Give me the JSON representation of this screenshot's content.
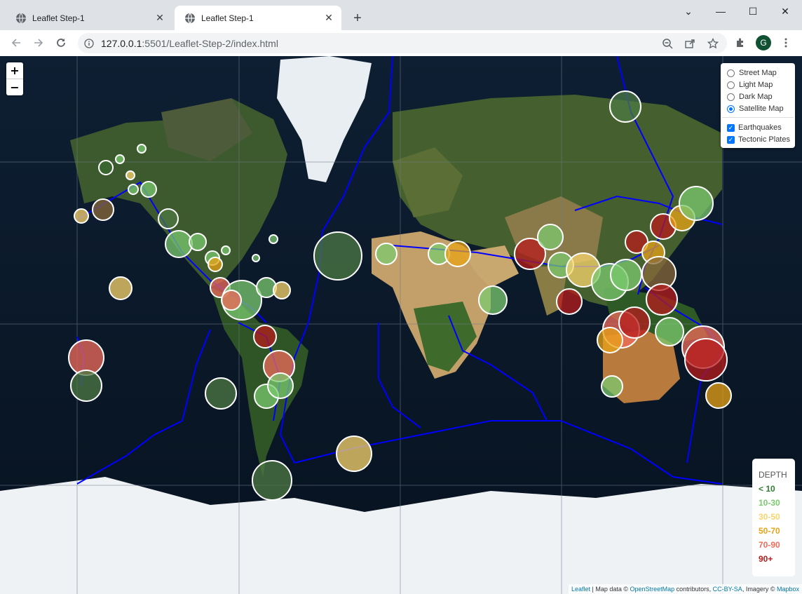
{
  "browser": {
    "tabs": [
      {
        "title": "Leaflet Step-1",
        "active": false
      },
      {
        "title": "Leaflet Step-1",
        "active": true
      }
    ],
    "url_host": "127.0.0.1",
    "url_path": ":5501/Leaflet-Step-2/index.html",
    "profile_initial": "G",
    "icons": {
      "favicon": "globe-icon",
      "close": "close-icon",
      "new_tab": "plus-icon",
      "back": "back-arrow-icon",
      "forward": "forward-arrow-icon",
      "reload": "reload-icon",
      "site_info": "info-icon",
      "zoom_out": "zoom-out-icon",
      "share": "share-icon",
      "bookmark": "star-icon",
      "extensions": "puzzle-icon",
      "menu": "kebab-menu-icon"
    }
  },
  "map": {
    "zoom_in_label": "+",
    "zoom_out_label": "−",
    "base_layers": [
      {
        "label": "Street Map",
        "selected": false
      },
      {
        "label": "Light Map",
        "selected": false
      },
      {
        "label": "Dark Map",
        "selected": false
      },
      {
        "label": "Satellite Map",
        "selected": true
      }
    ],
    "overlays": [
      {
        "label": "Earthquakes",
        "checked": true
      },
      {
        "label": "Tectonic Plates",
        "checked": true
      }
    ],
    "legend": {
      "title": "DEPTH",
      "items": [
        {
          "label": "< 10",
          "color": "#2e7d32"
        },
        {
          "label": "10-30",
          "color": "#7bc96f"
        },
        {
          "label": "30-50",
          "color": "#f9d56e"
        },
        {
          "label": "50-70",
          "color": "#e8a317"
        },
        {
          "label": "70-90",
          "color": "#f26b5b"
        },
        {
          "label": "90+",
          "color": "#b71c1c"
        }
      ]
    },
    "attribution": {
      "leaflet": "Leaflet",
      "text1": " | Map data © ",
      "osm": "OpenStreetMap",
      "text2": " contributors, ",
      "license": "CC-BY-SA",
      "text3": ", Imagery © ",
      "mapbox": "Mapbox"
    },
    "colors": {
      "plates": "#0000ff",
      "marker_stroke": "#ffffff"
    }
  }
}
